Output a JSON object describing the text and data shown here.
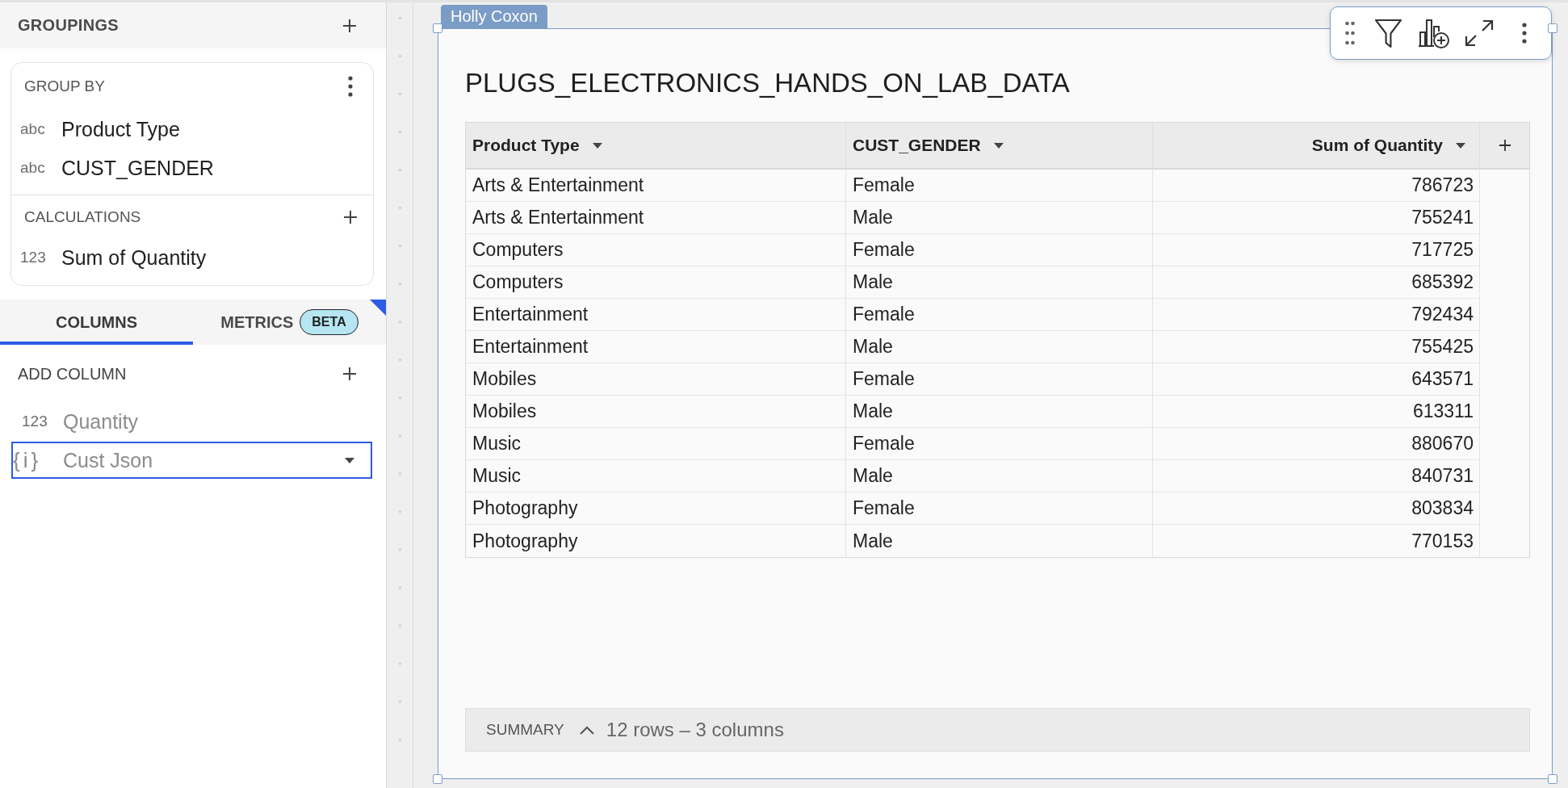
{
  "sidebar": {
    "groupings": {
      "title": "GROUPINGS"
    },
    "group_by": {
      "title": "GROUP BY",
      "items": [
        {
          "type_label": "abc",
          "name": "Product Type"
        },
        {
          "type_label": "abc",
          "name": "CUST_GENDER"
        }
      ]
    },
    "calculations": {
      "title": "CALCULATIONS",
      "items": [
        {
          "type_label": "123",
          "name": "Sum of Quantity"
        }
      ]
    },
    "tabs": [
      {
        "label": "COLUMNS",
        "selected": true
      },
      {
        "label": "METRICS",
        "badge": "BETA",
        "selected": false
      }
    ],
    "add_column": {
      "title": "ADD COLUMN"
    },
    "columns": [
      {
        "type_label": "123",
        "name": "Quantity",
        "dimmed": true,
        "selected": false
      },
      {
        "type_label": "{i}",
        "name": "Cust Json",
        "dimmed": true,
        "selected": true
      }
    ]
  },
  "canvas": {
    "author_tag": "Holly Coxon",
    "title": "PLUGS_ELECTRONICS_HANDS_ON_LAB_DATA",
    "table": {
      "columns": [
        {
          "label": "Product Type",
          "kind": "text"
        },
        {
          "label": "CUST_GENDER",
          "kind": "text"
        },
        {
          "label": "Sum of Quantity",
          "kind": "number"
        }
      ],
      "rows": [
        [
          "Arts & Entertainment",
          "Female",
          "786723"
        ],
        [
          "Arts & Entertainment",
          "Male",
          "755241"
        ],
        [
          "Computers",
          "Female",
          "717725"
        ],
        [
          "Computers",
          "Male",
          "685392"
        ],
        [
          "Entertainment",
          "Female",
          "792434"
        ],
        [
          "Entertainment",
          "Male",
          "755425"
        ],
        [
          "Mobiles",
          "Female",
          "643571"
        ],
        [
          "Mobiles",
          "Male",
          "613311"
        ],
        [
          "Music",
          "Female",
          "880670"
        ],
        [
          "Music",
          "Male",
          "840731"
        ],
        [
          "Photography",
          "Female",
          "803834"
        ],
        [
          "Photography",
          "Male",
          "770153"
        ]
      ]
    },
    "summary": {
      "label": "SUMMARY",
      "info": "12 rows – 3 columns"
    }
  }
}
